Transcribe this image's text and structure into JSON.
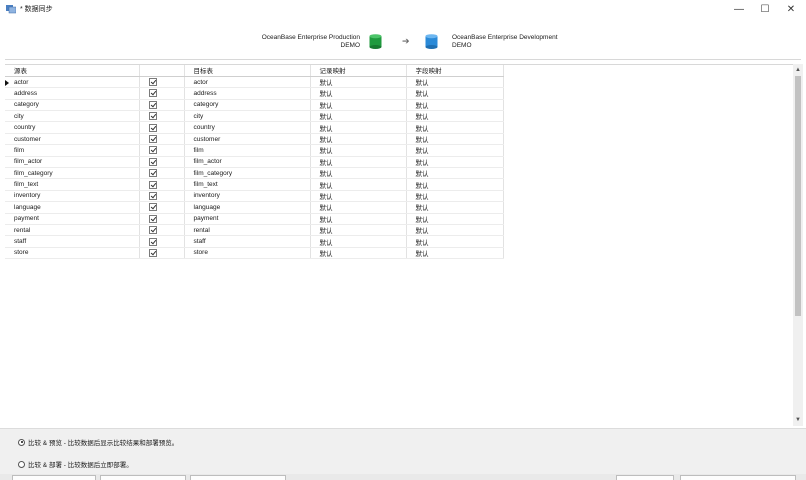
{
  "window": {
    "title": "* 数据同步",
    "controls": {
      "minimize": "—",
      "maximize": "☐",
      "close": "✕"
    }
  },
  "source_connection": {
    "name": "OceanBase Enterprise Production",
    "schema": "DEMO",
    "color": "#1f9a3e"
  },
  "target_connection": {
    "name": "OceanBase Enterprise Development",
    "schema": "DEMO",
    "color": "#2a8ad8"
  },
  "arrow_icon": "arrow-right-icon",
  "grid": {
    "columns": [
      "源表",
      "",
      "目标表",
      "记录映射",
      "字段映射"
    ],
    "rows": [
      {
        "source": "actor",
        "checked": true,
        "target": "actor",
        "record_map": "默认",
        "field_map": "默认"
      },
      {
        "source": "address",
        "checked": true,
        "target": "address",
        "record_map": "默认",
        "field_map": "默认"
      },
      {
        "source": "category",
        "checked": true,
        "target": "category",
        "record_map": "默认",
        "field_map": "默认"
      },
      {
        "source": "city",
        "checked": true,
        "target": "city",
        "record_map": "默认",
        "field_map": "默认"
      },
      {
        "source": "country",
        "checked": true,
        "target": "country",
        "record_map": "默认",
        "field_map": "默认"
      },
      {
        "source": "customer",
        "checked": true,
        "target": "customer",
        "record_map": "默认",
        "field_map": "默认"
      },
      {
        "source": "film",
        "checked": true,
        "target": "film",
        "record_map": "默认",
        "field_map": "默认"
      },
      {
        "source": "film_actor",
        "checked": true,
        "target": "film_actor",
        "record_map": "默认",
        "field_map": "默认"
      },
      {
        "source": "film_category",
        "checked": true,
        "target": "film_category",
        "record_map": "默认",
        "field_map": "默认"
      },
      {
        "source": "film_text",
        "checked": true,
        "target": "film_text",
        "record_map": "默认",
        "field_map": "默认"
      },
      {
        "source": "inventory",
        "checked": true,
        "target": "inventory",
        "record_map": "默认",
        "field_map": "默认"
      },
      {
        "source": "language",
        "checked": true,
        "target": "language",
        "record_map": "默认",
        "field_map": "默认"
      },
      {
        "source": "payment",
        "checked": true,
        "target": "payment",
        "record_map": "默认",
        "field_map": "默认"
      },
      {
        "source": "rental",
        "checked": true,
        "target": "rental",
        "record_map": "默认",
        "field_map": "默认"
      },
      {
        "source": "staff",
        "checked": true,
        "target": "staff",
        "record_map": "默认",
        "field_map": "默认"
      },
      {
        "source": "store",
        "checked": true,
        "target": "store",
        "record_map": "默认",
        "field_map": "默认"
      }
    ]
  },
  "options": [
    {
      "label": "比较 & 预览 - 比较数据后显示比较结果和部署预览。",
      "selected": true
    },
    {
      "label": "比较 & 部署 - 比较数据后立即部署。",
      "selected": false
    }
  ]
}
